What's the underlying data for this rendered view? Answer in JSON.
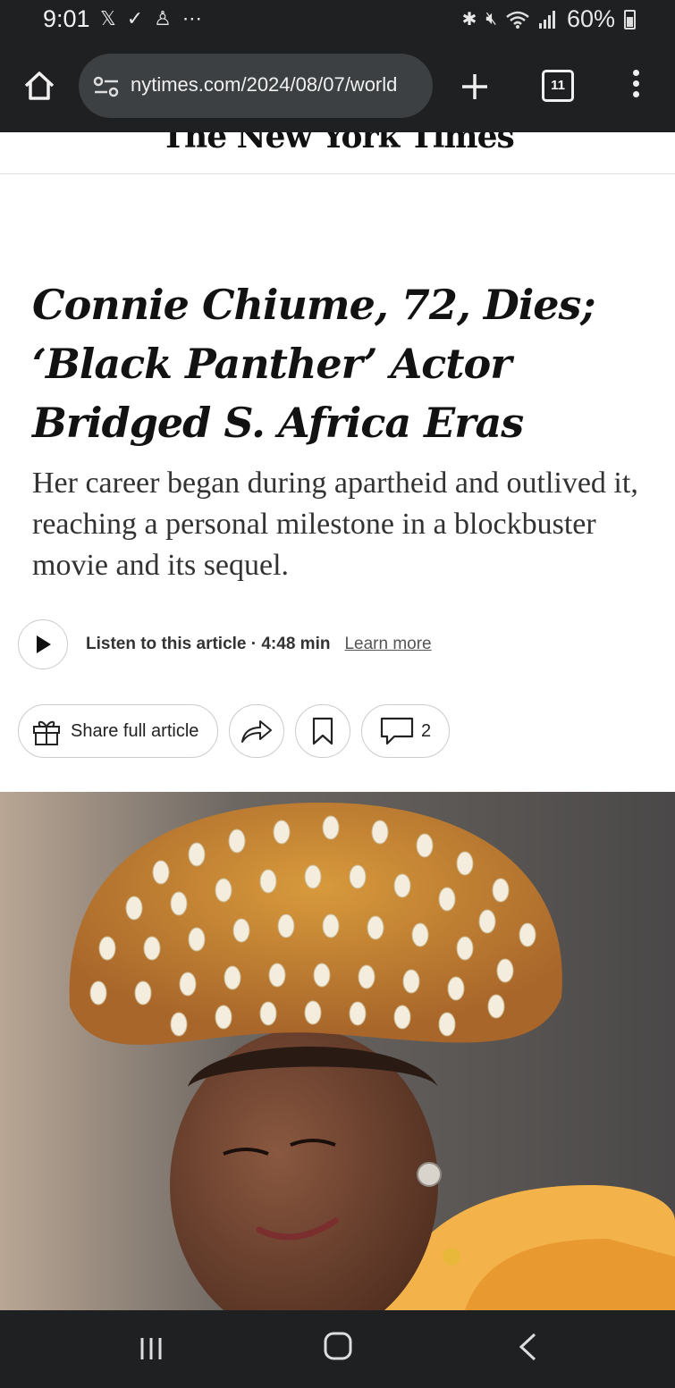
{
  "status_bar": {
    "time": "9:01",
    "left_icons": [
      "x-logo-icon",
      "check-icon",
      "playstation-icon",
      "more-dots-icon"
    ],
    "right_icons": [
      "bluetooth-icon",
      "mute-icon",
      "wifi-icon",
      "signal-icon",
      "battery-icon"
    ],
    "battery": "60%"
  },
  "browser": {
    "url": "nytimes.com/2024/08/07/world",
    "tab_count": "11"
  },
  "masthead": {
    "logo": "The New York Times"
  },
  "article": {
    "headline": "Connie Chiume, 72, Dies; ‘Black Panther’ Actor Bridged S. Africa Eras",
    "summary": "Her career began during apartheid and outlived it, reaching a personal milestone in a blockbuster movie and its sequel.",
    "listen_label": "Listen to this article · 4:48 min",
    "learn_more": "Learn more",
    "share_label": "Share full article",
    "comment_count": "2"
  },
  "photo": {
    "subject": "woman in beaded shell-covered headdress"
  },
  "colors": {
    "chrome": "#1f2022",
    "url_bar": "#3c4043",
    "headline": "#121212"
  }
}
